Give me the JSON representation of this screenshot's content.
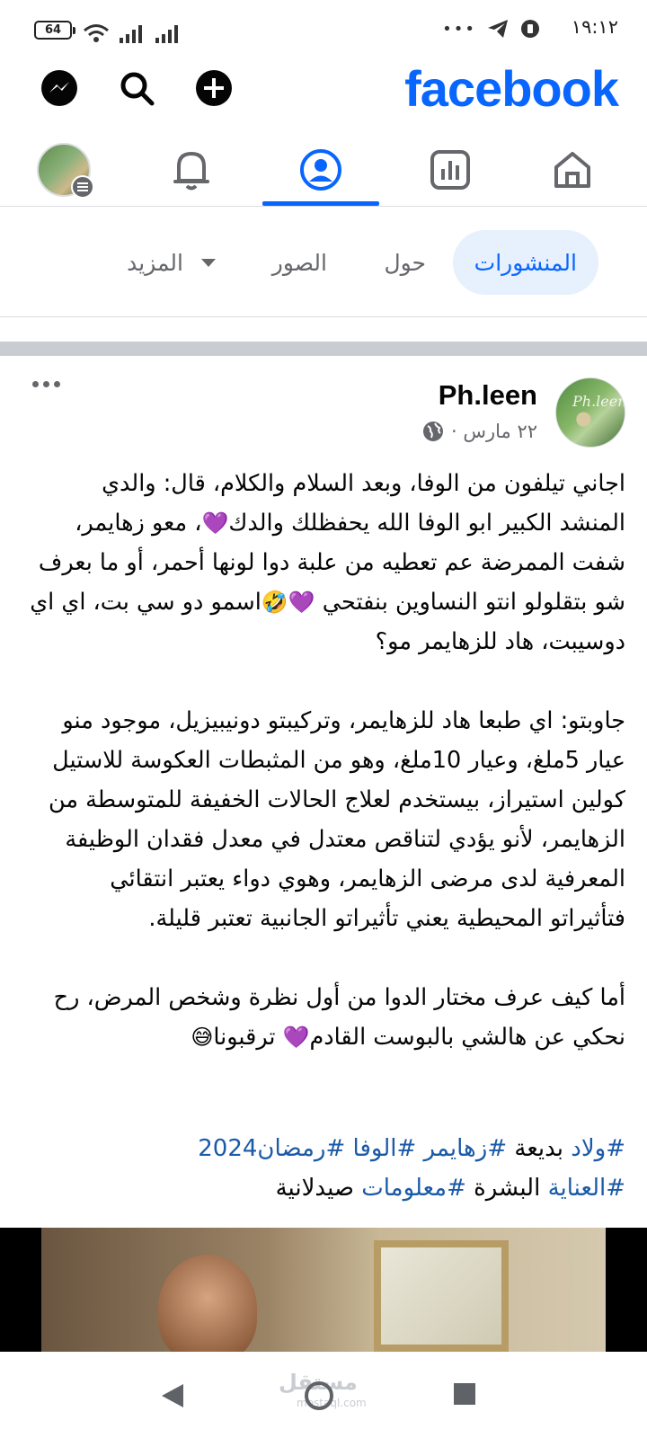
{
  "status_bar": {
    "time": "١٩:١٢",
    "battery": "64",
    "overflow": "•••"
  },
  "header": {
    "logo": "facebook",
    "icons": [
      "messenger-icon",
      "search-icon",
      "plus-icon"
    ]
  },
  "navbar": {
    "items": [
      "home-icon",
      "dashboard-icon",
      "profile-icon",
      "notifications-icon",
      "menu-avatar"
    ],
    "active": "profile"
  },
  "tabs": {
    "posts": "المنشورات",
    "about": "حول",
    "photos": "الصور",
    "more": "المزيد"
  },
  "post": {
    "author": "Ph.leen",
    "avatar_text": "Ph.leen",
    "date": "٢٢ مارس ·",
    "privacy_icon": "globe-icon",
    "p1_a": "اجاني تيلفون من الوفا، وبعد السلام والكلام، قال: والدي المنشد الكبير ابو الوفا الله يحفظلك والدك",
    "p1_b": "، معو زهايمر، شفت الممرضة عم تعطيه من علبة دوا لونها أحمر، أو ما بعرف شو بتقلولو انتو النساوين بنفتحي ",
    "p1_c": "اسمو دو سي بت، اي اي دوسيبت، هاد للزهايمر مو؟",
    "p2": "جاوبتو: اي طبعا هاد للزهايمر، وتركيبتو دونيبيزيل، موجود منو عيار 5ملغ، وعيار 10ملغ، وهو من المثبطات العكوسة للاستيل كولين استيراز، بيستخدم لعلاج الحالات الخفيفة للمتوسطة من الزهايمر، لأنو يؤدي لتناقص معتدل في معدل فقدان الوظيفة المعرفية لدى مرضى الزهايمر، وهوي دواء يعتبر انتقائي فتأثيراتو المحيطية يعني تأثيراتو الجانبية تعتبر قليلة.",
    "p3_a": "أما كيف عرف مختار الدوا من أول نظرة وشخص المرض، رح نحكي عن هالشي بالبوست القادم",
    "p3_b": " ترقبونا",
    "heart": "💜",
    "laugh": "🤣",
    "sweat": "😅",
    "hashtags_line1": [
      {
        "text": "#ولاد",
        "type": "tag"
      },
      {
        "text": " بديعة ",
        "type": "plain"
      },
      {
        "text": "#زهايمر",
        "type": "tag"
      },
      {
        "text": " ",
        "type": "plain"
      },
      {
        "text": "#الوفا",
        "type": "tag"
      },
      {
        "text": " ",
        "type": "plain"
      },
      {
        "text": "#رمضان2024",
        "type": "tag"
      }
    ],
    "hashtags_line2": [
      {
        "text": "#العناية",
        "type": "tag"
      },
      {
        "text": " البشرة ",
        "type": "plain"
      },
      {
        "text": "#معلومات",
        "type": "tag"
      },
      {
        "text": " صيدلانية",
        "type": "plain"
      }
    ]
  },
  "system_nav": {
    "watermark": "مستقل",
    "watermark_sub": "mostaql.com"
  },
  "colors": {
    "brand": "#0866ff",
    "tag": "#1a5aa8",
    "muted": "#65676b"
  }
}
